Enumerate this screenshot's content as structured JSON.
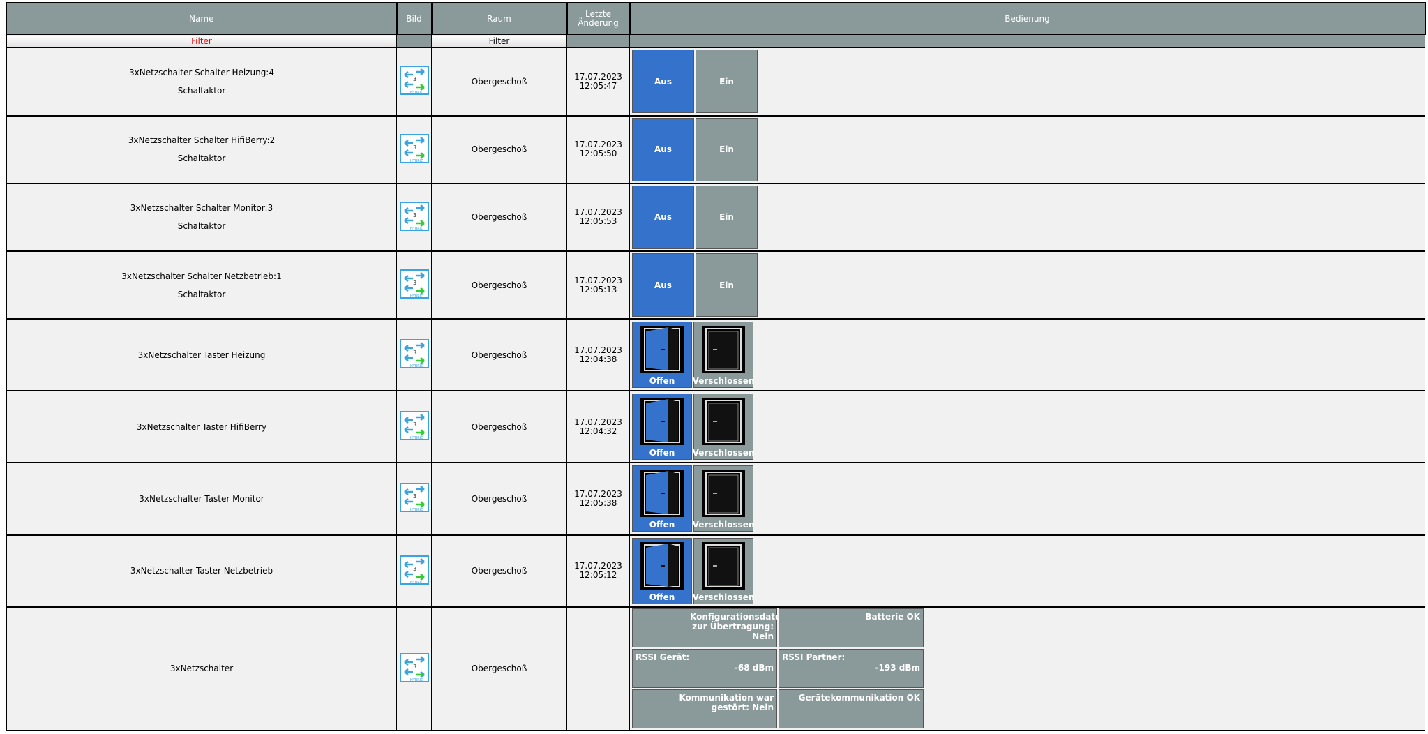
{
  "header": {
    "name": "Name",
    "image": "Bild",
    "room": "Raum",
    "last_change": "Letzte Änderung",
    "control": "Bedienung"
  },
  "filter": {
    "name_label": "Filter",
    "room_label": "Filter"
  },
  "icon": {
    "device_image": "hybrid-switch-icon",
    "door_open": "open-door-icon",
    "door_closed": "closed-door-icon"
  },
  "colors": {
    "header_bg": "#8a9a9a",
    "active_blue": "#3572cc",
    "inactive_gray": "#8a9a9a",
    "filter_red": "#e00000"
  },
  "switch_rows": [
    {
      "name": "3xNetzschalter Schalter Heizung:4",
      "type": "Schaltaktor",
      "room": "Obergeschoß",
      "date": "17.07.2023",
      "time": "12:05:47",
      "off_label": "Aus",
      "on_label": "Ein",
      "state": "Aus"
    },
    {
      "name": "3xNetzschalter Schalter HifiBerry:2",
      "type": "Schaltaktor",
      "room": "Obergeschoß",
      "date": "17.07.2023",
      "time": "12:05:50",
      "off_label": "Aus",
      "on_label": "Ein",
      "state": "Aus"
    },
    {
      "name": "3xNetzschalter Schalter Monitor:3",
      "type": "Schaltaktor",
      "room": "Obergeschoß",
      "date": "17.07.2023",
      "time": "12:05:53",
      "off_label": "Aus",
      "on_label": "Ein",
      "state": "Aus"
    },
    {
      "name": "3xNetzschalter Schalter Netzbetrieb:1",
      "type": "Schaltaktor",
      "room": "Obergeschoß",
      "date": "17.07.2023",
      "time": "12:05:13",
      "off_label": "Aus",
      "on_label": "Ein",
      "state": "Aus"
    }
  ],
  "button_rows": [
    {
      "name": "3xNetzschalter Taster Heizung",
      "room": "Obergeschoß",
      "date": "17.07.2023",
      "time": "12:04:38",
      "open_label": "Offen",
      "closed_label": "Verschlossen",
      "state": "Offen"
    },
    {
      "name": "3xNetzschalter Taster HifiBerry",
      "room": "Obergeschoß",
      "date": "17.07.2023",
      "time": "12:04:32",
      "open_label": "Offen",
      "closed_label": "Verschlossen",
      "state": "Offen"
    },
    {
      "name": "3xNetzschalter Taster Monitor",
      "room": "Obergeschoß",
      "date": "17.07.2023",
      "time": "12:05:38",
      "open_label": "Offen",
      "closed_label": "Verschlossen",
      "state": "Offen"
    },
    {
      "name": "3xNetzschalter Taster Netzbetrieb",
      "room": "Obergeschoß",
      "date": "17.07.2023",
      "time": "12:05:12",
      "open_label": "Offen",
      "closed_label": "Verschlossen",
      "state": "Offen"
    }
  ],
  "device_row": {
    "name": "3xNetzschalter",
    "room": "Obergeschoß",
    "config_pending": "Konfigurationsdaten zur Übertragung: Nein",
    "battery": "Batterie OK",
    "rssi_device_label": "RSSI Gerät:",
    "rssi_device_value": "-68 dBm",
    "rssi_partner_label": "RSSI Partner:",
    "rssi_partner_value": "-193 dBm",
    "comm_disturbed": "Kommunikation war gestört: Nein",
    "device_comm": "Gerätekommunikation OK"
  }
}
